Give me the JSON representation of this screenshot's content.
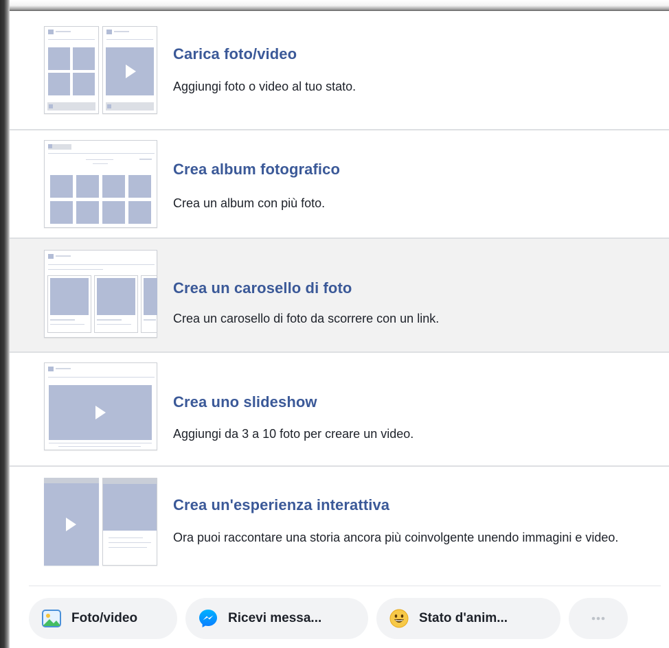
{
  "options": [
    {
      "title": "Carica foto/video",
      "description": "Aggiungi foto o video al tuo stato."
    },
    {
      "title": "Crea album fotografico",
      "description": "Crea un album con più foto."
    },
    {
      "title": "Crea un carosello di foto",
      "description": "Crea un carosello di foto da scorrere con un link."
    },
    {
      "title": "Crea uno slideshow",
      "description": "Aggiungi da 3 a 10 foto per creare un video."
    },
    {
      "title": "Crea un'esperienza interattiva",
      "description": "Ora puoi raccontare una storia ancora più coinvolgente unendo immagini e video."
    }
  ],
  "actions": [
    {
      "label": "Foto/video",
      "icon": "photo-icon"
    },
    {
      "label": "Ricevi messa...",
      "icon": "messenger-icon"
    },
    {
      "label": "Stato d'anim...",
      "icon": "smiley-icon"
    },
    {
      "label": "",
      "icon": "more-dots-icon"
    }
  ],
  "colors": {
    "title": "#3b5998",
    "text": "#1d2129",
    "highlight_row": "#f2f2f2",
    "thumbnail_fill": "#b2bcd6",
    "chip_bg": "#f2f3f5"
  }
}
